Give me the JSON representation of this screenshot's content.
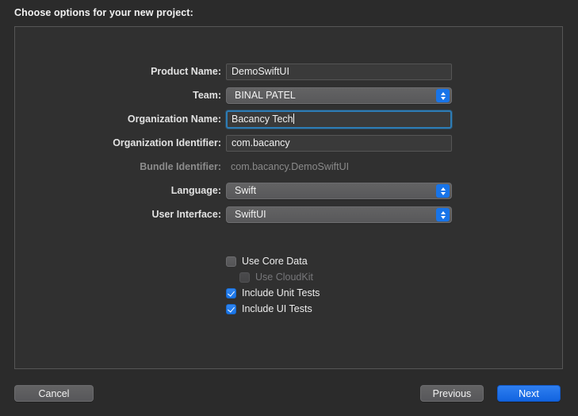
{
  "sheet": {
    "title": "Choose options for your new project:"
  },
  "form": {
    "rows": [
      {
        "label": "Product Name:",
        "type": "textfield",
        "value": "DemoSwiftUI",
        "placeholder": "",
        "focused": false
      },
      {
        "label": "Team:",
        "type": "popup",
        "value": "BINAL PATEL"
      },
      {
        "label": "Organization Name:",
        "type": "textfield",
        "value": "Bacancy Tech",
        "placeholder": "",
        "focused": true
      },
      {
        "label": "Organization Identifier:",
        "type": "textfield",
        "value": "com.bacancy",
        "placeholder": "",
        "focused": false
      },
      {
        "label": "Bundle Identifier:",
        "type": "static",
        "value": "com.bacancy.DemoSwiftUI"
      },
      {
        "label": "Language:",
        "type": "popup",
        "value": "Swift"
      },
      {
        "label": "User Interface:",
        "type": "popup",
        "value": "SwiftUI"
      }
    ]
  },
  "checkboxes": [
    {
      "label": "Use Core Data",
      "checked": false,
      "disabled": false,
      "indented": false
    },
    {
      "label": "Use CloudKit",
      "checked": false,
      "disabled": true,
      "indented": true
    },
    {
      "label": "Include Unit Tests",
      "checked": true,
      "disabled": false,
      "indented": false
    },
    {
      "label": "Include UI Tests",
      "checked": true,
      "disabled": false,
      "indented": false
    }
  ],
  "buttons": {
    "cancel": "Cancel",
    "previous": "Previous",
    "next": "Next"
  },
  "colors": {
    "accent": "#1874e8",
    "focus_ring": "#2d7cb5",
    "window_bg": "#2b2b2b",
    "panel_bg": "#303030",
    "field_bg": "#3a3a3a"
  }
}
